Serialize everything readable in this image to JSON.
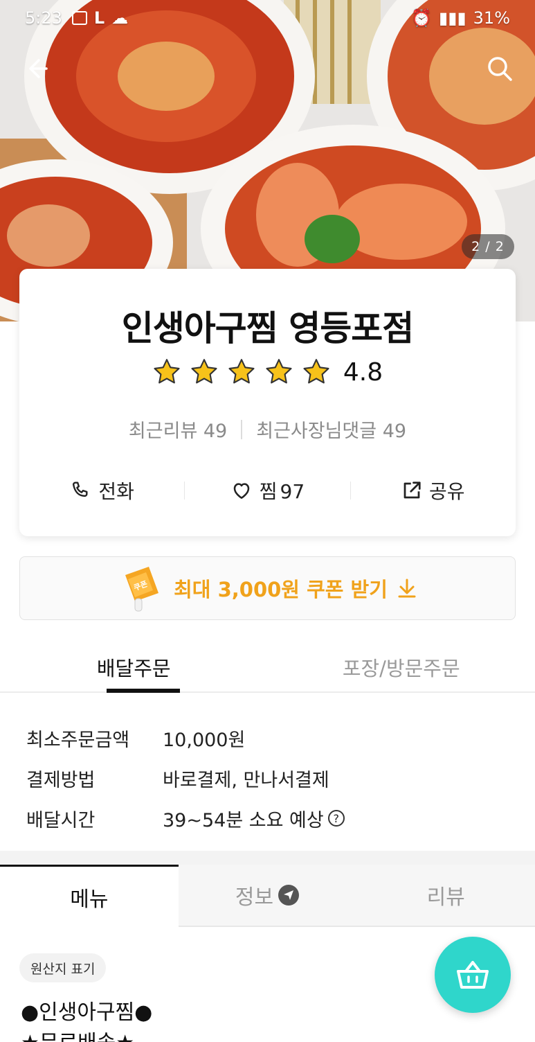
{
  "status_bar": {
    "time": "5:23",
    "battery": "31%"
  },
  "hero": {
    "image_counter": "2 / 2"
  },
  "store": {
    "name": "인생아구찜 영등포점",
    "rating": "4.8",
    "stars": 5,
    "recent_reviews_label": "최근리뷰 49",
    "owner_replies_label": "최근사장님댓글 49"
  },
  "actions": {
    "call_label": "전화",
    "favorite_label": "찜",
    "favorite_count": "97",
    "share_label": "공유"
  },
  "coupon": {
    "text": "최대 3,000원 쿠폰 받기",
    "badge_text": "쿠폰"
  },
  "order_tabs": {
    "delivery": "배달주문",
    "pickup": "포장/방문주문"
  },
  "info": [
    {
      "key": "최소주문금액",
      "value": "10,000원"
    },
    {
      "key": "결제방법",
      "value": "바로결제, 만나서결제"
    },
    {
      "key": "배달시간",
      "value": "39~54분 소요 예상"
    }
  ],
  "menu_tabs": {
    "menu": "메뉴",
    "info": "정보",
    "review": "리뷰"
  },
  "origin_label": "원산지 표기",
  "menu_header": "●인생아구찜●",
  "menu_subheader": "★무료배송★",
  "colors": {
    "accent_orange": "#f0a21b",
    "cart_teal": "#2fd6cb",
    "star_yellow": "#f7c21a"
  }
}
